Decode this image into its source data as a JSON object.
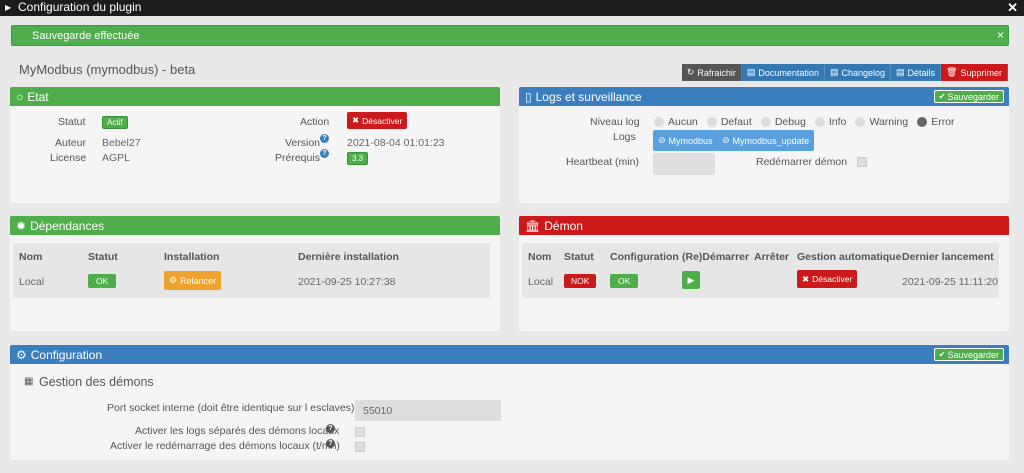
{
  "window": {
    "title": "Configuration du plugin"
  },
  "alert": {
    "message": "Sauvegarde effectuée",
    "close": "×"
  },
  "plugin": {
    "title": "MyModbus (mymodbus) - beta"
  },
  "toolbar": {
    "refresh": "Rafraichir",
    "documentation": "Documentation",
    "changelog": "Changelog",
    "details": "Détails",
    "delete": "Supprimer"
  },
  "etat": {
    "title": "Etat",
    "statut_label": "Statut",
    "statut_value": "Actif",
    "auteur_label": "Auteur",
    "auteur_value": "Bebel27",
    "license_label": "License",
    "license_value": "AGPL",
    "action_label": "Action",
    "action_button": "Désactiver",
    "version_label": "Version",
    "version_value": "2021-08-04 01:01:23",
    "prerequis_label": "Prérequis",
    "prerequis_value": "3.3"
  },
  "logs": {
    "title": "Logs et surveillance",
    "save": "Sauvegarder",
    "niveau_label": "Niveau log",
    "levels": [
      "Aucun",
      "Defaut",
      "Debug",
      "Info",
      "Warning",
      "Error"
    ],
    "selected_level": "Error",
    "logs_label": "Logs",
    "log_buttons": [
      "Mymodbus",
      "Mymodbus_update"
    ],
    "heartbeat_label": "Heartbeat (min)",
    "redemarrer_label": "Redémarrer démon"
  },
  "dependances": {
    "title": "Dépendances",
    "headers": [
      "Nom",
      "Statut",
      "Installation",
      "Dernière installation"
    ],
    "row": {
      "nom": "Local",
      "statut": "OK",
      "installation": "Relancer",
      "date": "2021-09-25 10:27:38"
    }
  },
  "demon": {
    "title": "Démon",
    "headers": [
      "Nom",
      "Statut",
      "Configuration",
      "(Re)Démarrer",
      "Arrêter",
      "Gestion automatique",
      "Dernier lancement"
    ],
    "row": {
      "nom": "Local",
      "statut": "NOK",
      "configuration": "OK",
      "gestion": "Désactiver",
      "date": "2021-09-25 11:11:20"
    }
  },
  "configuration": {
    "title": "Configuration",
    "save": "Sauvegarder",
    "section": "Gestion des démons",
    "port_label": "Port socket interne (doit être identique sur l esclaves)",
    "port_value": "55010",
    "logs_sep_label": "Activer les logs séparés des démons locaux",
    "redemarrage_label": "Activer le redémarrage des démons locaux (t/mn)"
  },
  "colors": {
    "green": "#4fae4b",
    "blue": "#3a7ec0",
    "red": "#cc1a1a",
    "orange": "#f0a22e"
  }
}
